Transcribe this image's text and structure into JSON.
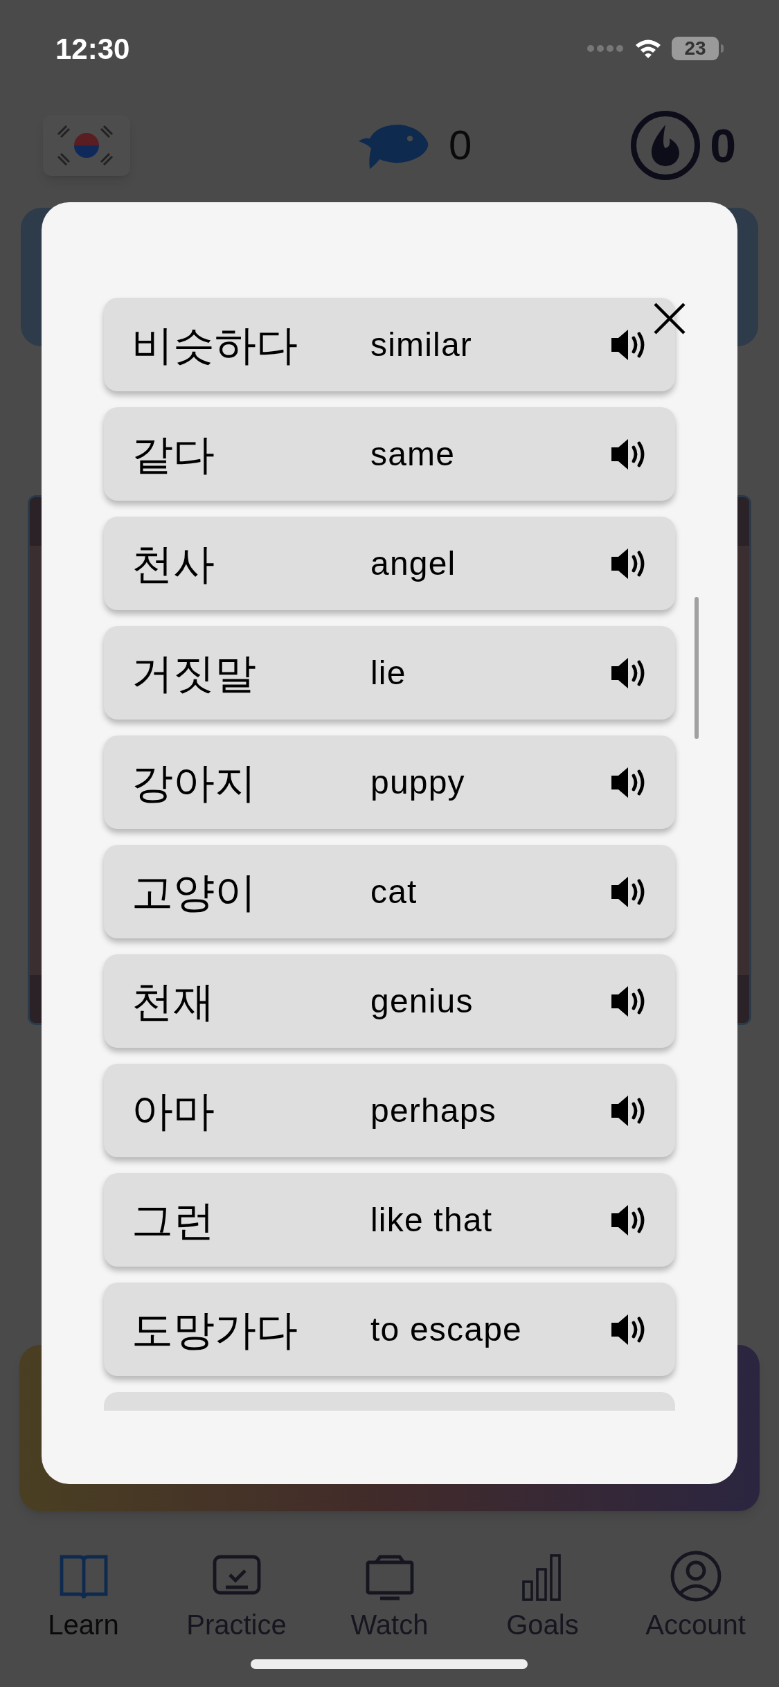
{
  "status_bar": {
    "time": "12:30",
    "battery": "23"
  },
  "header": {
    "fish_count": "0",
    "streak_count": "0"
  },
  "modal": {
    "words": [
      {
        "korean": "비슷하다",
        "english": "similar"
      },
      {
        "korean": "같다",
        "english": "same"
      },
      {
        "korean": "천사",
        "english": "angel"
      },
      {
        "korean": "거짓말",
        "english": "lie"
      },
      {
        "korean": "강아지",
        "english": "puppy"
      },
      {
        "korean": "고양이",
        "english": "cat"
      },
      {
        "korean": "천재",
        "english": "genius"
      },
      {
        "korean": "아마",
        "english": "perhaps"
      },
      {
        "korean": "그런",
        "english": "like that"
      },
      {
        "korean": "도망가다",
        "english": "to escape"
      }
    ]
  },
  "tab_bar": [
    {
      "label": "Learn",
      "kind": "book",
      "selected": true
    },
    {
      "label": "Practice",
      "kind": "practice",
      "selected": false
    },
    {
      "label": "Watch",
      "kind": "tv",
      "selected": false
    },
    {
      "label": "Goals",
      "kind": "bars",
      "selected": false
    },
    {
      "label": "Account",
      "kind": "account",
      "selected": false
    }
  ]
}
